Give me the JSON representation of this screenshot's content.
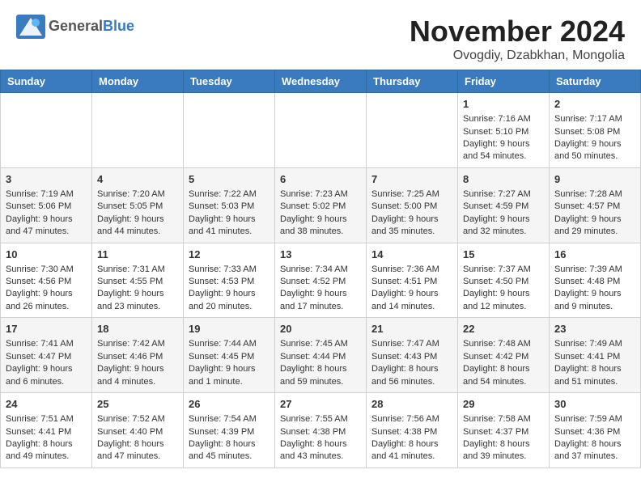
{
  "header": {
    "logo_general": "General",
    "logo_blue": "Blue",
    "month_title": "November 2024",
    "location": "Ovogdiy, Dzabkhan, Mongolia"
  },
  "days_of_week": [
    "Sunday",
    "Monday",
    "Tuesday",
    "Wednesday",
    "Thursday",
    "Friday",
    "Saturday"
  ],
  "weeks": [
    [
      {
        "day": "",
        "info": ""
      },
      {
        "day": "",
        "info": ""
      },
      {
        "day": "",
        "info": ""
      },
      {
        "day": "",
        "info": ""
      },
      {
        "day": "",
        "info": ""
      },
      {
        "day": "1",
        "info": "Sunrise: 7:16 AM\nSunset: 5:10 PM\nDaylight: 9 hours and 54 minutes."
      },
      {
        "day": "2",
        "info": "Sunrise: 7:17 AM\nSunset: 5:08 PM\nDaylight: 9 hours and 50 minutes."
      }
    ],
    [
      {
        "day": "3",
        "info": "Sunrise: 7:19 AM\nSunset: 5:06 PM\nDaylight: 9 hours and 47 minutes."
      },
      {
        "day": "4",
        "info": "Sunrise: 7:20 AM\nSunset: 5:05 PM\nDaylight: 9 hours and 44 minutes."
      },
      {
        "day": "5",
        "info": "Sunrise: 7:22 AM\nSunset: 5:03 PM\nDaylight: 9 hours and 41 minutes."
      },
      {
        "day": "6",
        "info": "Sunrise: 7:23 AM\nSunset: 5:02 PM\nDaylight: 9 hours and 38 minutes."
      },
      {
        "day": "7",
        "info": "Sunrise: 7:25 AM\nSunset: 5:00 PM\nDaylight: 9 hours and 35 minutes."
      },
      {
        "day": "8",
        "info": "Sunrise: 7:27 AM\nSunset: 4:59 PM\nDaylight: 9 hours and 32 minutes."
      },
      {
        "day": "9",
        "info": "Sunrise: 7:28 AM\nSunset: 4:57 PM\nDaylight: 9 hours and 29 minutes."
      }
    ],
    [
      {
        "day": "10",
        "info": "Sunrise: 7:30 AM\nSunset: 4:56 PM\nDaylight: 9 hours and 26 minutes."
      },
      {
        "day": "11",
        "info": "Sunrise: 7:31 AM\nSunset: 4:55 PM\nDaylight: 9 hours and 23 minutes."
      },
      {
        "day": "12",
        "info": "Sunrise: 7:33 AM\nSunset: 4:53 PM\nDaylight: 9 hours and 20 minutes."
      },
      {
        "day": "13",
        "info": "Sunrise: 7:34 AM\nSunset: 4:52 PM\nDaylight: 9 hours and 17 minutes."
      },
      {
        "day": "14",
        "info": "Sunrise: 7:36 AM\nSunset: 4:51 PM\nDaylight: 9 hours and 14 minutes."
      },
      {
        "day": "15",
        "info": "Sunrise: 7:37 AM\nSunset: 4:50 PM\nDaylight: 9 hours and 12 minutes."
      },
      {
        "day": "16",
        "info": "Sunrise: 7:39 AM\nSunset: 4:48 PM\nDaylight: 9 hours and 9 minutes."
      }
    ],
    [
      {
        "day": "17",
        "info": "Sunrise: 7:41 AM\nSunset: 4:47 PM\nDaylight: 9 hours and 6 minutes."
      },
      {
        "day": "18",
        "info": "Sunrise: 7:42 AM\nSunset: 4:46 PM\nDaylight: 9 hours and 4 minutes."
      },
      {
        "day": "19",
        "info": "Sunrise: 7:44 AM\nSunset: 4:45 PM\nDaylight: 9 hours and 1 minute."
      },
      {
        "day": "20",
        "info": "Sunrise: 7:45 AM\nSunset: 4:44 PM\nDaylight: 8 hours and 59 minutes."
      },
      {
        "day": "21",
        "info": "Sunrise: 7:47 AM\nSunset: 4:43 PM\nDaylight: 8 hours and 56 minutes."
      },
      {
        "day": "22",
        "info": "Sunrise: 7:48 AM\nSunset: 4:42 PM\nDaylight: 8 hours and 54 minutes."
      },
      {
        "day": "23",
        "info": "Sunrise: 7:49 AM\nSunset: 4:41 PM\nDaylight: 8 hours and 51 minutes."
      }
    ],
    [
      {
        "day": "24",
        "info": "Sunrise: 7:51 AM\nSunset: 4:41 PM\nDaylight: 8 hours and 49 minutes."
      },
      {
        "day": "25",
        "info": "Sunrise: 7:52 AM\nSunset: 4:40 PM\nDaylight: 8 hours and 47 minutes."
      },
      {
        "day": "26",
        "info": "Sunrise: 7:54 AM\nSunset: 4:39 PM\nDaylight: 8 hours and 45 minutes."
      },
      {
        "day": "27",
        "info": "Sunrise: 7:55 AM\nSunset: 4:38 PM\nDaylight: 8 hours and 43 minutes."
      },
      {
        "day": "28",
        "info": "Sunrise: 7:56 AM\nSunset: 4:38 PM\nDaylight: 8 hours and 41 minutes."
      },
      {
        "day": "29",
        "info": "Sunrise: 7:58 AM\nSunset: 4:37 PM\nDaylight: 8 hours and 39 minutes."
      },
      {
        "day": "30",
        "info": "Sunrise: 7:59 AM\nSunset: 4:36 PM\nDaylight: 8 hours and 37 minutes."
      }
    ]
  ]
}
